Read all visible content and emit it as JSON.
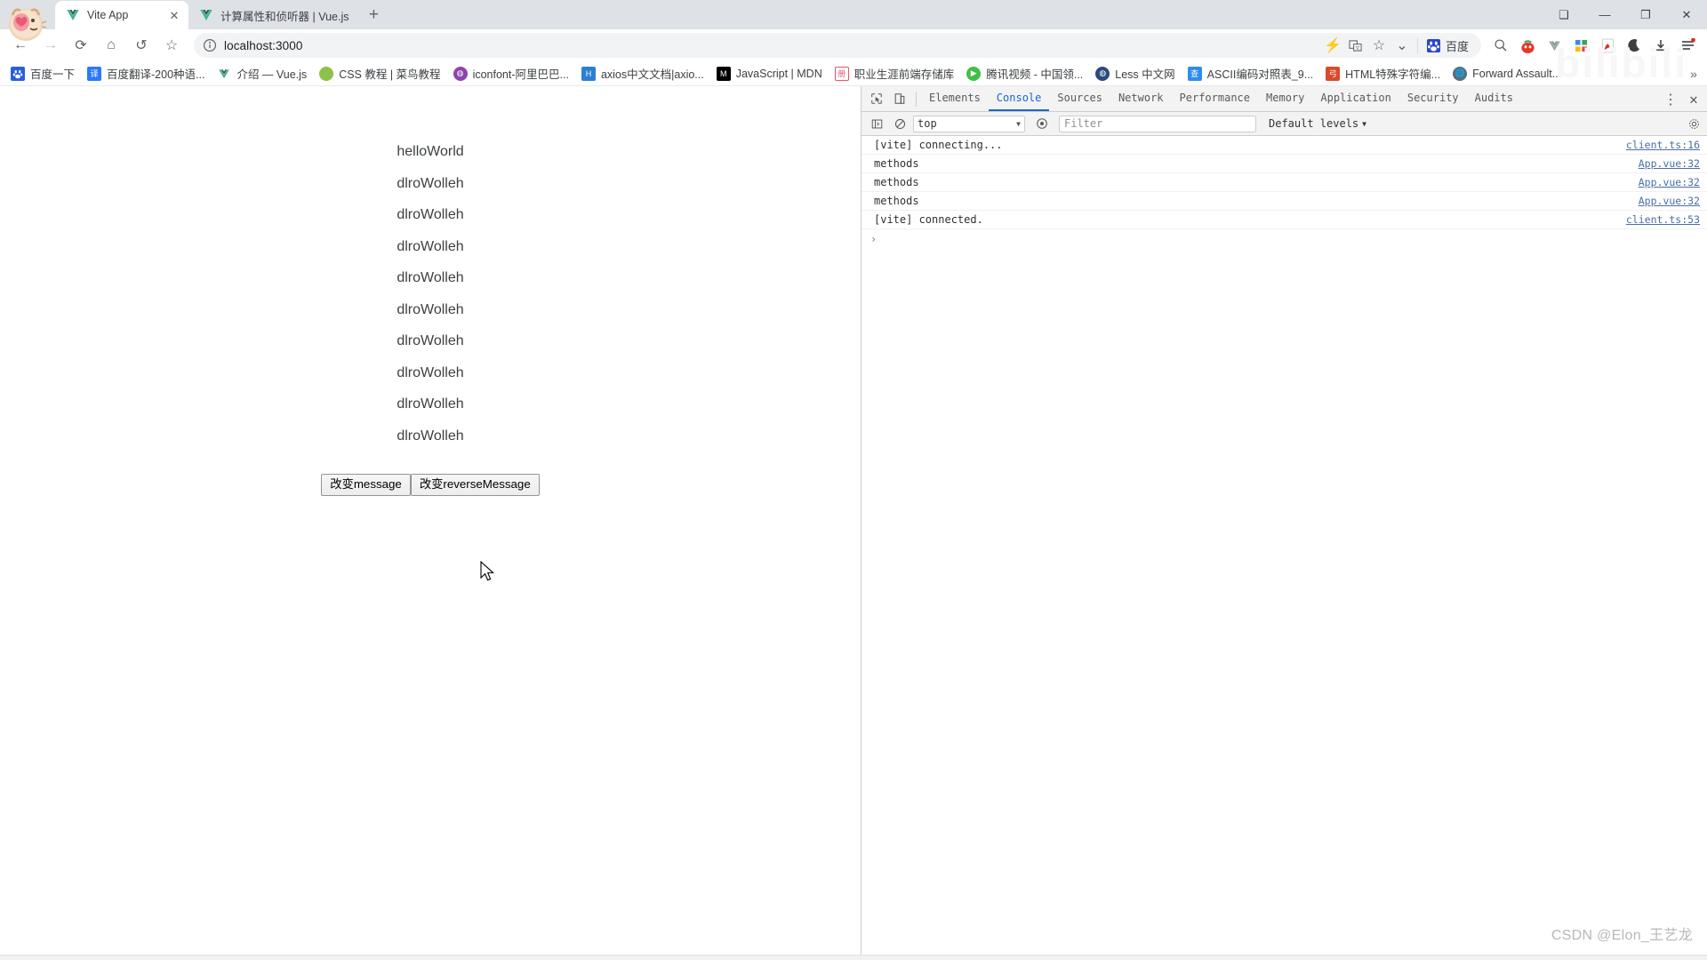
{
  "browser": {
    "window_controls": [
      {
        "name": "restore-tabs-button",
        "glyph": "❏"
      },
      {
        "name": "minimize-button",
        "glyph": "—"
      },
      {
        "name": "maximize-button",
        "glyph": "❐"
      },
      {
        "name": "close-button",
        "glyph": "✕"
      }
    ],
    "tabs": [
      {
        "title": "Vite App",
        "icon": "vue-logo-icon",
        "active": true
      },
      {
        "title": "计算属性和侦听器 | Vue.js",
        "icon": "vue-logo-icon",
        "active": false
      }
    ],
    "new_tab_label": "+",
    "nav": {
      "back_label": "←",
      "forward_label": "→",
      "reload_label": "⟳",
      "home_label": "⌂",
      "history_back_label": "↺",
      "bookmark_star_label": "☆"
    },
    "omnibox": {
      "info_icon": "info-circle-icon",
      "url": "localhost:3000",
      "lightning_icon": "lightning-icon",
      "translate_icon": "translate-icon",
      "star_icon": "star-icon",
      "chevron_icon": "chevron-down-icon",
      "search_engine_label": "百度",
      "search_engine_icon": "baidu-paw-icon",
      "search_icon": "magnifier-icon"
    },
    "extensions": [
      {
        "name": "search-extension-icon",
        "glyph": "🔍"
      },
      {
        "name": "tomato-timer-extension-icon",
        "glyph": "⏱"
      },
      {
        "name": "vue-devtools-extension-icon",
        "glyph": "V"
      },
      {
        "name": "grid-apps-extension-icon",
        "glyph": "▦"
      },
      {
        "name": "pdf-extension-icon",
        "glyph": "📕"
      },
      {
        "name": "dark-mode-extension-icon",
        "glyph": "☾"
      },
      {
        "name": "downloads-button-icon",
        "glyph": "⤓"
      },
      {
        "name": "chrome-menu-icon",
        "glyph": "☰"
      }
    ],
    "bookmarks": [
      {
        "label": "百度一下",
        "icon": "baidu-icon",
        "color": "#2b5fd9"
      },
      {
        "label": "百度翻译-200种语...",
        "icon": "baidu-translate-icon",
        "color": "#2979ff"
      },
      {
        "label": "介绍 — Vue.js",
        "icon": "vue-icon",
        "color": "#41b883"
      },
      {
        "label": "CSS 教程 | 菜鸟教程",
        "icon": "runoob-icon",
        "color": "#8bc34a"
      },
      {
        "label": "iconfont-阿里巴巴...",
        "icon": "iconfont-icon",
        "color": "#8e44ad"
      },
      {
        "label": "axios中文文档|axio...",
        "icon": "axios-icon",
        "color": "#2b7fd4"
      },
      {
        "label": "JavaScript | MDN",
        "icon": "mdn-icon",
        "color": "#000000"
      },
      {
        "label": "职业生涯前端存储库",
        "icon": "storage-icon",
        "color": "#e8536b"
      },
      {
        "label": "腾讯视频 - 中国领...",
        "icon": "tencent-video-icon",
        "color": "#3fbf46"
      },
      {
        "label": "Less 中文网",
        "icon": "less-icon",
        "color": "#2a4b7c"
      },
      {
        "label": "ASCII编码对照表_9...",
        "icon": "ascii-table-icon",
        "color": "#2d8cf0"
      },
      {
        "label": "HTML特殊字符编...",
        "icon": "html-entities-icon",
        "color": "#d94a2b"
      },
      {
        "label": "Forward Assault...",
        "icon": "globe-icon",
        "color": "#5a6b7a"
      }
    ],
    "bookmarks_overflow_label": "»"
  },
  "page": {
    "messages": [
      "helloWorld",
      "dlroWolleh",
      "dlroWolleh",
      "dlroWolleh",
      "dlroWolleh",
      "dlroWolleh",
      "dlroWolleh",
      "dlroWolleh",
      "dlroWolleh",
      "dlroWolleh"
    ],
    "buttons": [
      {
        "label": "改变message",
        "name": "change-message-button"
      },
      {
        "label": "改变reverseMessage",
        "name": "change-reverse-message-button"
      }
    ]
  },
  "devtools": {
    "inspect_icon": "inspect-element-icon",
    "device_icon": "device-toolbar-icon",
    "tabs": [
      {
        "label": "Elements",
        "selected": false
      },
      {
        "label": "Console",
        "selected": true
      },
      {
        "label": "Sources",
        "selected": false
      },
      {
        "label": "Network",
        "selected": false
      },
      {
        "label": "Performance",
        "selected": false
      },
      {
        "label": "Memory",
        "selected": false
      },
      {
        "label": "Application",
        "selected": false
      },
      {
        "label": "Security",
        "selected": false
      },
      {
        "label": "Audits",
        "selected": false
      }
    ],
    "more_icon": "kebab-menu-icon",
    "close_icon": "close-icon",
    "toolbar": {
      "sidebar_icon": "console-sidebar-icon",
      "clear_icon": "clear-console-icon",
      "context": "top",
      "eye_icon": "live-expression-icon",
      "filter_placeholder": "Filter",
      "levels_label": "Default levels",
      "settings_icon": "gear-icon"
    },
    "logs": [
      {
        "text": "[vite] connecting...",
        "source": "client.ts:16"
      },
      {
        "text": "methods",
        "source": "App.vue:32"
      },
      {
        "text": "methods",
        "source": "App.vue:32"
      },
      {
        "text": "methods",
        "source": "App.vue:32"
      },
      {
        "text": "[vite] connected.",
        "source": "client.ts:53"
      }
    ],
    "prompt_caret": "›"
  },
  "watermark": {
    "text": "CSDN @Elon_王艺龙"
  },
  "background_text": {
    "bilibili": "bilibili"
  }
}
